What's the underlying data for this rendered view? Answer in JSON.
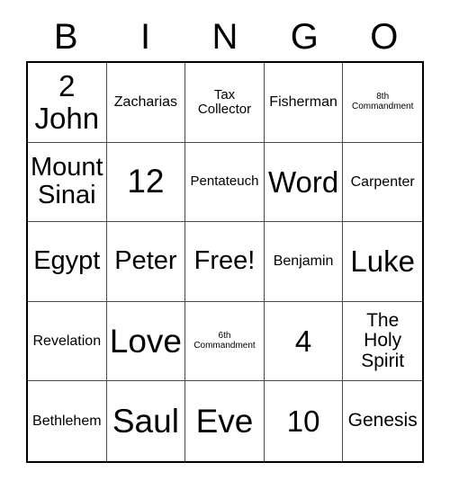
{
  "card": {
    "header_letters": [
      "B",
      "I",
      "N",
      "G",
      "O"
    ],
    "rows": [
      [
        {
          "text": "2 John",
          "size": "fs-xl"
        },
        {
          "text": "Zacharias",
          "size": "fs-s"
        },
        {
          "text": "Tax Collector",
          "size": "fs-xs"
        },
        {
          "text": "Fisherman",
          "size": "fs-s"
        },
        {
          "text": "8th Commandment",
          "size": "fs-xxs"
        }
      ],
      [
        {
          "text": "Mount Sinai",
          "size": "fs-l"
        },
        {
          "text": "12",
          "size": "fs-xxl"
        },
        {
          "text": "Pentateuch",
          "size": "fs-xs"
        },
        {
          "text": "Word",
          "size": "fs-xl"
        },
        {
          "text": "Carpenter",
          "size": "fs-s"
        }
      ],
      [
        {
          "text": "Egypt",
          "size": "fs-l"
        },
        {
          "text": "Peter",
          "size": "fs-l"
        },
        {
          "text": "Free!",
          "size": "fs-l"
        },
        {
          "text": "Benjamin",
          "size": "fs-s"
        },
        {
          "text": "Luke",
          "size": "fs-xl"
        }
      ],
      [
        {
          "text": "Revelation",
          "size": "fs-s"
        },
        {
          "text": "Love",
          "size": "fs-xxl"
        },
        {
          "text": "6th Commandment",
          "size": "fs-xxs"
        },
        {
          "text": "4",
          "size": "fs-xl"
        },
        {
          "text": "The Holy Spirit",
          "size": "fs-m"
        }
      ],
      [
        {
          "text": "Bethlehem",
          "size": "fs-s"
        },
        {
          "text": "Saul",
          "size": "fs-xxl"
        },
        {
          "text": "Eve",
          "size": "fs-xxl"
        },
        {
          "text": "10",
          "size": "fs-xl"
        },
        {
          "text": "Genesis",
          "size": "fs-m"
        }
      ]
    ],
    "colors": {
      "background": "#ffffff",
      "text": "#000000",
      "outer_border": "#000000",
      "inner_border": "#4a4a4a"
    }
  }
}
